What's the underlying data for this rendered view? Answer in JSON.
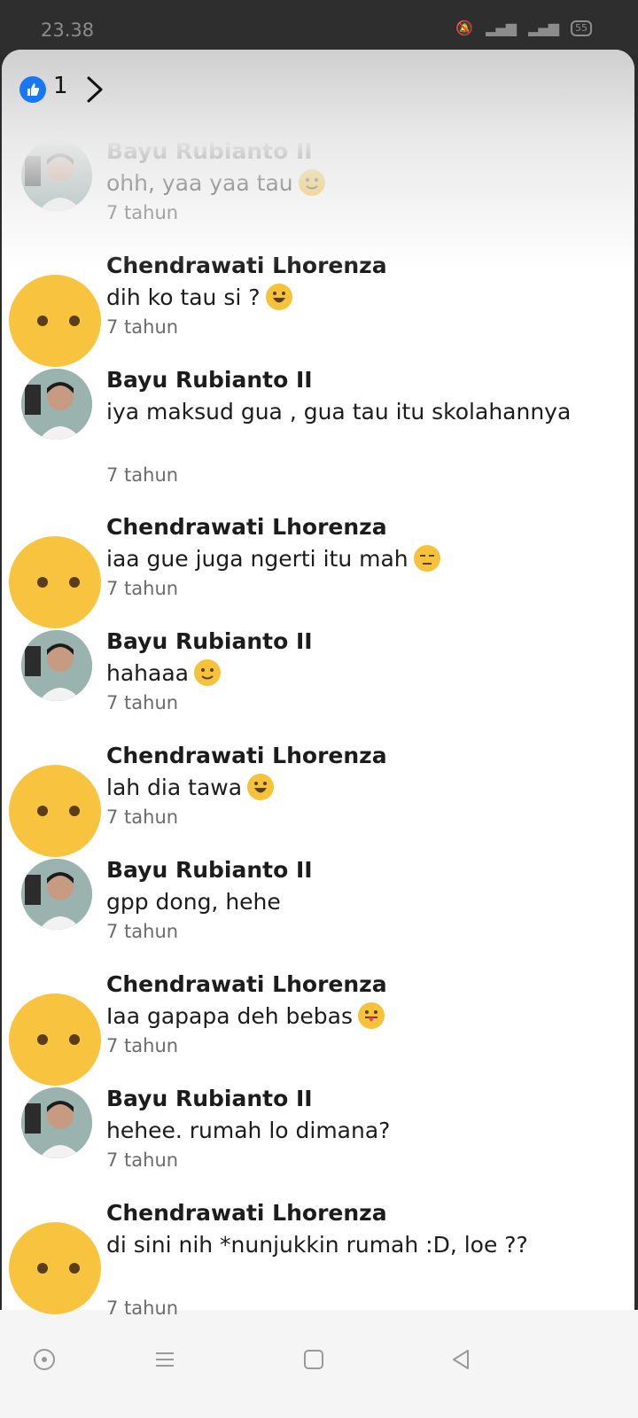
{
  "status_bar": {
    "time": "23.38",
    "network": "4G",
    "battery": "55"
  },
  "header": {
    "reaction_count": "1"
  },
  "comments": [
    {
      "author": "Bayu Rubianto II",
      "text": "ohh, yaa yaa tau",
      "emoji": "slightly-smiling",
      "time": "7 tahun",
      "avatar": "photo"
    },
    {
      "author": "Chendrawati Lhorenza",
      "text": "dih ko tau si ?",
      "emoji": "grinning",
      "time": "7 tahun",
      "avatar": "emoji-face"
    },
    {
      "author": "Bayu Rubianto II",
      "text": "iya maksud gua , gua tau itu skolahannya",
      "emoji": "",
      "time": "7 tahun",
      "avatar": "photo"
    },
    {
      "author": "Chendrawati Lhorenza",
      "text": "iaa gue juga ngerti itu mah",
      "emoji": "unamused",
      "time": "7 tahun",
      "avatar": "emoji-face"
    },
    {
      "author": "Bayu Rubianto II",
      "text": "hahaaa",
      "emoji": "slightly-smiling",
      "time": "7 tahun",
      "avatar": "photo"
    },
    {
      "author": "Chendrawati Lhorenza",
      "text": "lah dia tawa",
      "emoji": "grinning",
      "time": "7 tahun",
      "avatar": "emoji-face"
    },
    {
      "author": "Bayu Rubianto II",
      "text": "gpp dong, hehe",
      "emoji": "",
      "time": "7 tahun",
      "avatar": "photo"
    },
    {
      "author": "Chendrawati Lhorenza",
      "text": "Iaa gapapa deh bebas",
      "emoji": "tongue-out",
      "time": "7 tahun",
      "avatar": "emoji-face"
    },
    {
      "author": "Bayu Rubianto II",
      "text": "hehee. rumah lo dimana?",
      "emoji": "",
      "time": "7 tahun",
      "avatar": "photo"
    },
    {
      "author": "Chendrawati Lhorenza",
      "text": "di sini nih *nunjukkin rumah :D, loe ??",
      "emoji": "",
      "time": "7 tahun",
      "avatar": "emoji-face"
    }
  ],
  "colors": {
    "like": "#1877f2",
    "emoji_face": "#f8c440",
    "author": "#1c1c1c",
    "time": "#6b6b6b"
  }
}
